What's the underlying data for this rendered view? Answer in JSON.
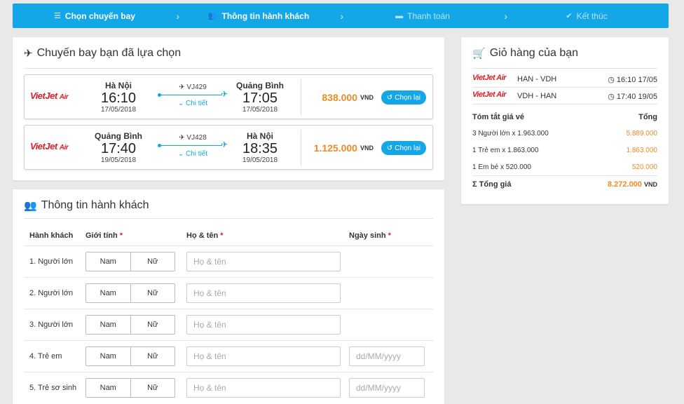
{
  "steps": [
    {
      "label": "Chọn chuyến bay",
      "icon": "list-icon"
    },
    {
      "label": "Thông tin hành khách",
      "icon": "users-icon"
    },
    {
      "label": "Thanh toán",
      "icon": "credit-card-icon"
    },
    {
      "label": "Kết thúc",
      "icon": "check-circle-icon"
    }
  ],
  "flights_panel": {
    "title": "Chuyến bay bạn đã lựa chọn",
    "flights": [
      {
        "airline": "Vietjet Air",
        "from_city": "Hà Nội",
        "from_time": "16:10",
        "from_date": "17/05/2018",
        "flight_no": "VJ429",
        "detail": "Chi tiết",
        "to_city": "Quảng Bình",
        "to_time": "17:05",
        "to_date": "17/05/2018",
        "price": "838.000",
        "currency": "VND",
        "reselect": "Chọn lại"
      },
      {
        "airline": "Vietjet Air",
        "from_city": "Quảng Bình",
        "from_time": "17:40",
        "from_date": "19/05/2018",
        "flight_no": "VJ428",
        "detail": "Chi tiết",
        "to_city": "Hà Nội",
        "to_time": "18:35",
        "to_date": "19/05/2018",
        "price": "1.125.000",
        "currency": "VND",
        "reselect": "Chọn lại"
      }
    ]
  },
  "passengers_panel": {
    "title": "Thông tin hành khách",
    "headers": {
      "passenger": "Hành khách",
      "gender": "Giới tính",
      "name": "Họ & tên",
      "dob": "Ngày sinh",
      "required": "*"
    },
    "gender_options": {
      "male": "Nam",
      "female": "Nữ"
    },
    "name_placeholder": "Họ & tên",
    "dob_placeholder": "dd/MM/yyyy",
    "rows": [
      {
        "label": "1. Người lớn"
      },
      {
        "label": "2. Người lớn"
      },
      {
        "label": "3. Người lớn"
      },
      {
        "label": "4. Trẻ em"
      },
      {
        "label": "5. Trẻ sơ sinh"
      }
    ]
  },
  "cart": {
    "title": "Giỏ hàng của bạn",
    "items": [
      {
        "airline": "Vietjet Air",
        "route": "HAN - VDH",
        "time": "16:10 17/05"
      },
      {
        "airline": "Vietjet Air",
        "route": "VDH - HAN",
        "time": "17:40 19/05"
      }
    ],
    "summary_title": "Tóm tắt giá vé",
    "summary_total_col": "Tổng",
    "lines": [
      {
        "label": "3 Người lớn x 1.963.000",
        "value": "5.889.000"
      },
      {
        "label": "1 Trẻ em x 1.863.000",
        "value": "1.863.000"
      },
      {
        "label": "1 Em bé x 520.000",
        "value": "520.000"
      }
    ],
    "total_label": "Σ Tổng giá",
    "total_value": "8.272.000",
    "total_currency": "VND"
  },
  "colors": {
    "accent": "#13a7e8",
    "price": "#f08a24",
    "brand": "#d81f2a"
  }
}
